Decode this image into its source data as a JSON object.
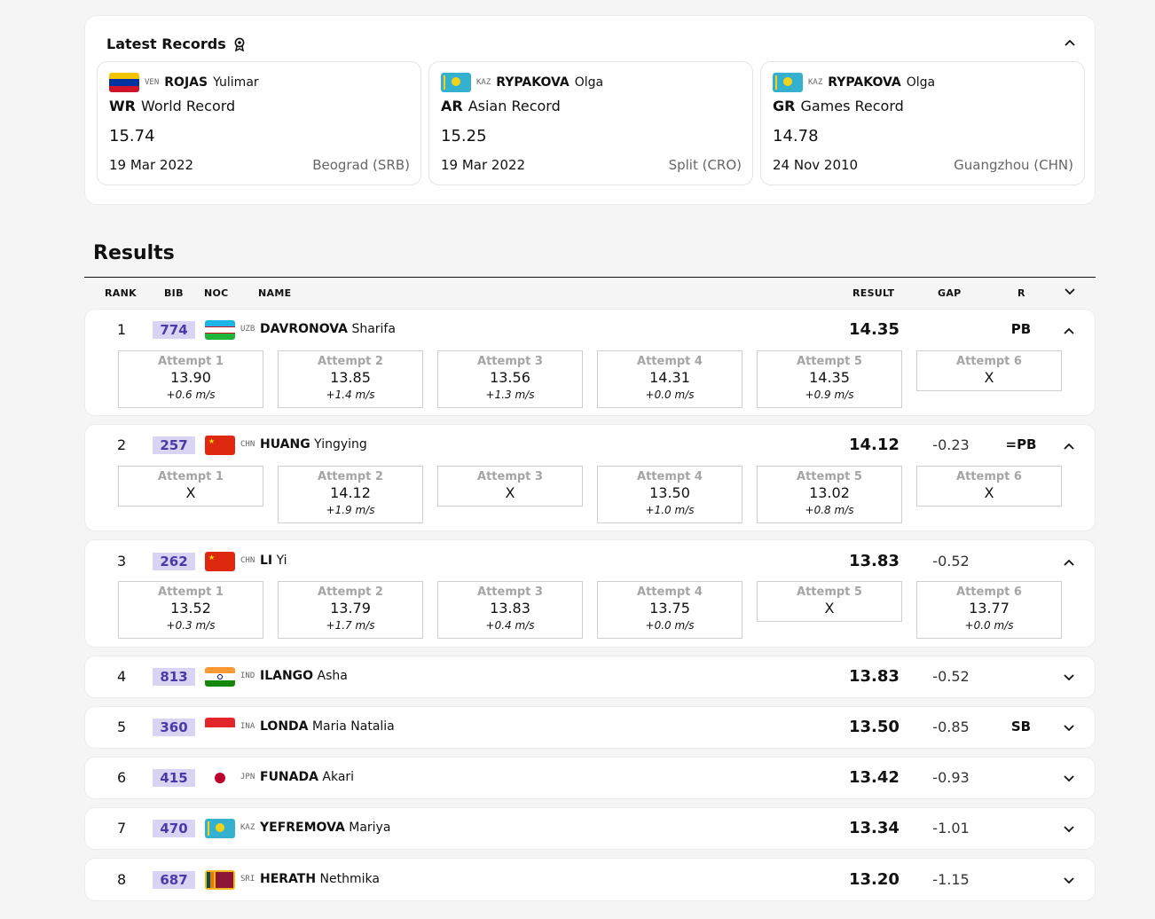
{
  "records": {
    "title": "Latest Records",
    "toggle": "^",
    "items": [
      {
        "noc": "VEN",
        "surname": "ROJAS",
        "given": "Yulimar",
        "abbr": "WR",
        "type": "World Record",
        "mark": "15.74",
        "date": "19 Mar 2022",
        "venue": "Beograd (SRB)"
      },
      {
        "noc": "KAZ",
        "surname": "RYPAKOVA",
        "given": "Olga",
        "abbr": "AR",
        "type": "Asian Record",
        "mark": "15.25",
        "date": "19 Mar 2022",
        "venue": "Split (CRO)"
      },
      {
        "noc": "KAZ",
        "surname": "RYPAKOVA",
        "given": "Olga",
        "abbr": "GR",
        "type": "Games Record",
        "mark": "14.78",
        "date": "24 Nov 2010",
        "venue": "Guangzhou (CHN)"
      }
    ]
  },
  "results": {
    "title": "Results",
    "headers": {
      "rank": "RANK",
      "bib": "BIB",
      "noc": "NOC",
      "name": "NAME",
      "result": "RESULT",
      "gap": "GAP",
      "r": "R"
    },
    "attempt_labels": [
      "Attempt 1",
      "Attempt 2",
      "Attempt 3",
      "Attempt 4",
      "Attempt 5",
      "Attempt 6"
    ],
    "rows": [
      {
        "rank": "1",
        "bib": "774",
        "noc": "UZB",
        "surname": "DAVRONOVA",
        "given": "Sharifa",
        "result": "14.35",
        "gap": "",
        "r": "PB",
        "expanded": true,
        "attempts": [
          {
            "val": "13.90",
            "wind": "+0.6 m/s"
          },
          {
            "val": "13.85",
            "wind": "+1.4 m/s"
          },
          {
            "val": "13.56",
            "wind": "+1.3 m/s"
          },
          {
            "val": "14.31",
            "wind": "+0.0 m/s"
          },
          {
            "val": "14.35",
            "wind": "+0.9 m/s"
          },
          {
            "val": "X",
            "wind": ""
          }
        ]
      },
      {
        "rank": "2",
        "bib": "257",
        "noc": "CHN",
        "surname": "HUANG",
        "given": "Yingying",
        "result": "14.12",
        "gap": "-0.23",
        "r": "=PB",
        "expanded": true,
        "attempts": [
          {
            "val": "X",
            "wind": ""
          },
          {
            "val": "14.12",
            "wind": "+1.9 m/s"
          },
          {
            "val": "X",
            "wind": ""
          },
          {
            "val": "13.50",
            "wind": "+1.0 m/s"
          },
          {
            "val": "13.02",
            "wind": "+0.8 m/s"
          },
          {
            "val": "X",
            "wind": ""
          }
        ]
      },
      {
        "rank": "3",
        "bib": "262",
        "noc": "CHN",
        "surname": "LI",
        "given": "Yi",
        "result": "13.83",
        "gap": "-0.52",
        "r": "",
        "expanded": true,
        "attempts": [
          {
            "val": "13.52",
            "wind": "+0.3 m/s"
          },
          {
            "val": "13.79",
            "wind": "+1.7 m/s"
          },
          {
            "val": "13.83",
            "wind": "+0.4 m/s"
          },
          {
            "val": "13.75",
            "wind": "+0.0 m/s"
          },
          {
            "val": "X",
            "wind": ""
          },
          {
            "val": "13.77",
            "wind": "+0.0 m/s"
          }
        ]
      },
      {
        "rank": "4",
        "bib": "813",
        "noc": "IND",
        "surname": "ILANGO",
        "given": "Asha",
        "result": "13.83",
        "gap": "-0.52",
        "r": "",
        "expanded": false
      },
      {
        "rank": "5",
        "bib": "360",
        "noc": "INA",
        "surname": "LONDA",
        "given": "Maria Natalia",
        "result": "13.50",
        "gap": "-0.85",
        "r": "SB",
        "expanded": false
      },
      {
        "rank": "6",
        "bib": "415",
        "noc": "JPN",
        "surname": "FUNADA",
        "given": "Akari",
        "result": "13.42",
        "gap": "-0.93",
        "r": "",
        "expanded": false
      },
      {
        "rank": "7",
        "bib": "470",
        "noc": "KAZ",
        "surname": "YEFREMOVA",
        "given": "Mariya",
        "result": "13.34",
        "gap": "-1.01",
        "r": "",
        "expanded": false
      },
      {
        "rank": "8",
        "bib": "687",
        "noc": "SRI",
        "surname": "HERATH",
        "given": "Nethmika",
        "result": "13.20",
        "gap": "-1.15",
        "r": "",
        "expanded": false
      }
    ]
  }
}
